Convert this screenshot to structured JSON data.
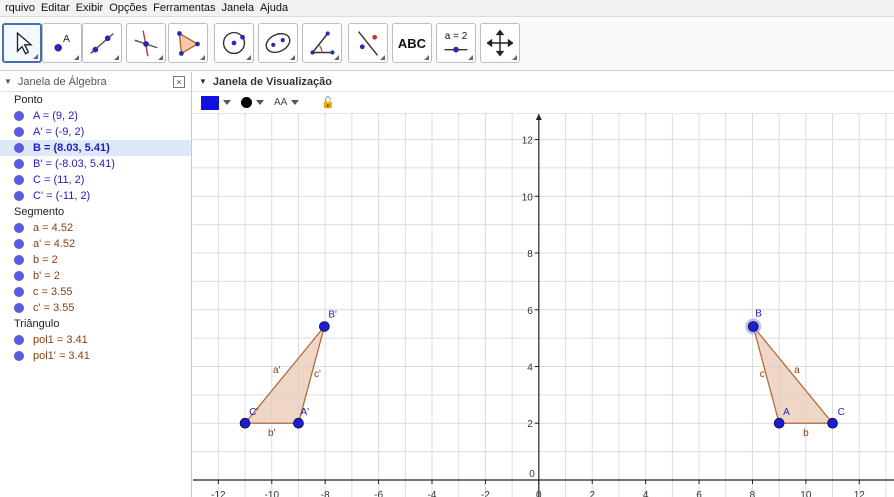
{
  "menubar": {
    "items": [
      "rquivo",
      "Editar",
      "Exibir",
      "Opções",
      "Ferramentas",
      "Janela",
      "Ajuda"
    ]
  },
  "toolbar": {
    "tools": [
      {
        "name": "move-tool",
        "icon": "cursor-arrow-icon",
        "active": true
      },
      {
        "name": "point-tool",
        "icon": "point-a-icon"
      },
      {
        "name": "line-tool",
        "icon": "line-through-points-icon"
      },
      {
        "name": "perpendicular-tool",
        "icon": "perpendicular-line-icon"
      },
      {
        "name": "polygon-tool",
        "icon": "polygon-icon"
      },
      {
        "name": "circle-tool",
        "icon": "circle-center-point-icon"
      },
      {
        "name": "ellipse-tool",
        "icon": "ellipse-icon"
      },
      {
        "name": "angle-tool",
        "icon": "angle-icon"
      },
      {
        "name": "reflect-tool",
        "icon": "reflect-about-line-icon"
      },
      {
        "name": "text-tool",
        "icon": "text-abc-icon",
        "label": "ABC"
      },
      {
        "name": "slider-tool",
        "icon": "slider-icon",
        "label": "a = 2"
      },
      {
        "name": "move-view-tool",
        "icon": "move-graphics-view-icon"
      }
    ]
  },
  "algebra": {
    "title": "Janela de Álgebra",
    "close_label": "×",
    "categories": [
      {
        "label": "Ponto",
        "kind": "point",
        "items": [
          {
            "text": "A = (9, 2)"
          },
          {
            "text": "A' = (-9, 2)"
          },
          {
            "text": "B = (8.03, 5.41)",
            "selected": true
          },
          {
            "text": "B' = (-8.03, 5.41)"
          },
          {
            "text": "C = (11, 2)"
          },
          {
            "text": "C' = (-11, 2)"
          }
        ]
      },
      {
        "label": "Segmento",
        "kind": "segment",
        "items": [
          {
            "text": "a = 4.52"
          },
          {
            "text": "a' = 4.52"
          },
          {
            "text": "b = 2"
          },
          {
            "text": "b' = 2"
          },
          {
            "text": "c = 3.55"
          },
          {
            "text": "c' = 3.55"
          }
        ]
      },
      {
        "label": "Triângulo",
        "kind": "triangle",
        "items": [
          {
            "text": "pol1 = 3.41"
          },
          {
            "text": "pol1' = 3.41"
          }
        ]
      }
    ]
  },
  "view": {
    "title": "Janela de Visualização",
    "style_bar": {
      "color": "#1010e0",
      "point_style": "●",
      "label_style": "AA",
      "lock": "🔓"
    }
  },
  "colors": {
    "point": "#1d1dbf",
    "segment": "#8a3e10",
    "triangle_fill": "#e8c9b4",
    "triangle_stroke": "#b06a3c",
    "grid": "#dcdcdc",
    "axis": "#222222",
    "point_dot": "#5b5bdc"
  },
  "chart_data": {
    "type": "scatter",
    "xlim": [
      -12.95,
      13.3
    ],
    "ylim": [
      -0.6,
      12.9
    ],
    "grid": true,
    "x_ticks": [
      -12,
      -10,
      -8,
      -6,
      -4,
      -2,
      0,
      2,
      4,
      6,
      8,
      10,
      12
    ],
    "y_ticks": [
      2,
      4,
      6,
      8,
      10,
      12
    ],
    "x_tick_labels": [
      "-12",
      "-10",
      "-8",
      "-6",
      "-4",
      "-2",
      "0",
      "2",
      "4",
      "6",
      "8",
      "10",
      "12"
    ],
    "y_tick_labels": [
      "2",
      "4",
      "6",
      "8",
      "10",
      "12"
    ],
    "points": [
      {
        "label": "A",
        "x": 9,
        "y": 2
      },
      {
        "label": "A'",
        "x": -9,
        "y": 2
      },
      {
        "label": "B",
        "x": 8.03,
        "y": 5.41,
        "selected": true
      },
      {
        "label": "B'",
        "x": -8.03,
        "y": 5.41
      },
      {
        "label": "C",
        "x": 11,
        "y": 2
      },
      {
        "label": "C'",
        "x": -11,
        "y": 2
      }
    ],
    "segments": [
      {
        "label": "a",
        "from": "B",
        "to": "C"
      },
      {
        "label": "b",
        "from": "A",
        "to": "C"
      },
      {
        "label": "c",
        "from": "A",
        "to": "B"
      },
      {
        "label": "a'",
        "from": "B'",
        "to": "C'"
      },
      {
        "label": "b'",
        "from": "A'",
        "to": "C'"
      },
      {
        "label": "c'",
        "from": "A'",
        "to": "B'"
      }
    ],
    "polygons": [
      {
        "label": "pol1",
        "vertices": [
          "A",
          "B",
          "C"
        ]
      },
      {
        "label": "pol1'",
        "vertices": [
          "A'",
          "B'",
          "C'"
        ]
      }
    ]
  }
}
